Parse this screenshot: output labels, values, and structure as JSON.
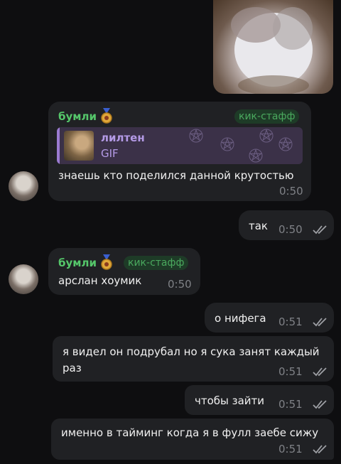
{
  "chat": {
    "messages": [
      {
        "sender": "бумли",
        "badge": "кик-стафф",
        "reply": {
          "name": "лилтен",
          "type": "GIF"
        },
        "text": "знаешь кто поделился данной крутостью",
        "time": "0:50"
      },
      {
        "text": "так",
        "time": "0:50"
      },
      {
        "sender": "бумли",
        "badge": "кик-стафф",
        "text": "арслан хоумик",
        "time": "0:50"
      },
      {
        "text": "о нифега",
        "time": "0:51"
      },
      {
        "text_line1": "я видел он подрубал но я сука занят каждый",
        "text_line2": "раз",
        "time": "0:51"
      },
      {
        "text": "чтобы зайти",
        "time": "0:51"
      },
      {
        "text": "именно в тайминг когда я в фулл заебе сижу",
        "time": "0:51"
      }
    ]
  },
  "colors": {
    "background": "#0e0e10",
    "bubble": "#202124",
    "sender": "#55c66a",
    "reply_accent": "#9b7bd1",
    "time": "#7f8186"
  }
}
